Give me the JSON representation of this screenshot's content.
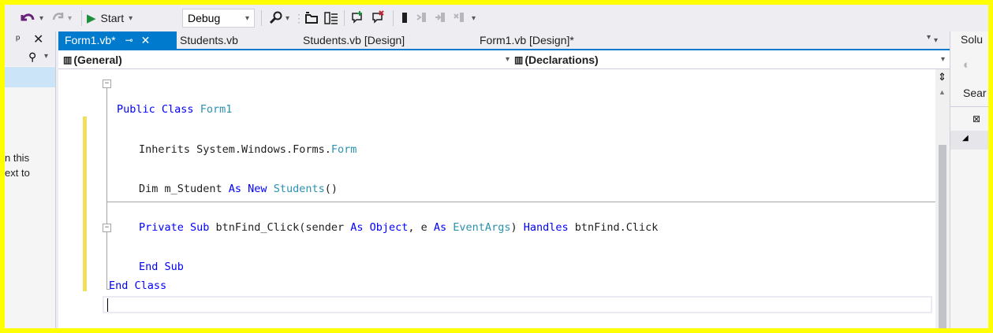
{
  "toolbar": {
    "start_label": "Start",
    "config_value": "Debug"
  },
  "left_panel": {
    "line1": "n this",
    "line2": "ext to"
  },
  "tabs": [
    {
      "label": "Form1.vb*",
      "active": true
    },
    {
      "label": "Students.vb"
    },
    {
      "label": "Students.vb [Design]"
    },
    {
      "label": "Form1.vb [Design]*"
    }
  ],
  "navbar": {
    "left_value": "(General)",
    "right_value": "(Declarations)"
  },
  "code": {
    "l1_kw": "Public Class",
    "l1_name": "Form1",
    "l2_text": "Inherits System.Windows.Forms.",
    "l2_type": "Form",
    "l3_a": "Dim m_Student ",
    "l3_kw": "As New",
    "l3_type": "Students",
    "l3_end": "()",
    "l4_kw1": "Private Sub",
    "l4_a": " btnFind_Click(sender ",
    "l4_kw2": "As Object",
    "l4_b": ", e ",
    "l4_kw3": "As",
    "l4_type": "EventArgs",
    "l4_c": ") ",
    "l4_kw4": "Handles",
    "l4_d": " btnFind.Click",
    "l5_kw": "End Sub",
    "l6_kw": "End Class"
  },
  "right_panel": {
    "title": "Solu",
    "search": "Sear"
  },
  "colors": {
    "border_highlight": "#ffff00",
    "accent": "#007acc",
    "keyword": "#0000ff",
    "type": "#2b91af",
    "change_bar": "#efe15e"
  }
}
